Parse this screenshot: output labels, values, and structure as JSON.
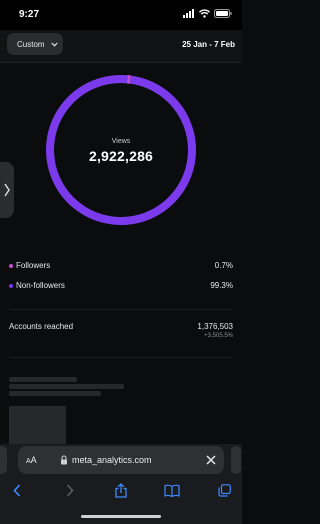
{
  "status": {
    "time": "9:27"
  },
  "filter": {
    "range_label": "Custom",
    "date_range": "25 Jan - 7 Feb"
  },
  "views": {
    "label": "Views",
    "value": "2,922,286"
  },
  "chart_data": {
    "type": "pie",
    "categories": [
      "Followers",
      "Non-followers"
    ],
    "values": [
      0.7,
      99.3
    ],
    "colors": [
      "#c64bd1",
      "#7c3aed"
    ],
    "title": "",
    "center_label": "Views",
    "center_value": "2,922,286"
  },
  "legend": [
    {
      "label": "Followers",
      "percent": "0.7%",
      "color": "#c64bd1"
    },
    {
      "label": "Non-followers",
      "percent": "99.3%",
      "color": "#7c3aed"
    }
  ],
  "accounts_reached": {
    "label": "Accounts reached",
    "value": "1,376,503",
    "delta": "+3,505.5%"
  },
  "browser": {
    "aa_small": "A",
    "aa_large": "A",
    "url": "meta_analytics.com"
  },
  "colors": {
    "accent": "#7c3aed",
    "followers": "#c64bd1",
    "link": "#3d8bff",
    "background": "#0b0c0e"
  },
  "icons": [
    "signal-icon",
    "wifi-icon",
    "battery-icon",
    "chevron-down-icon",
    "chevron-right-icon",
    "lock-icon",
    "close-icon",
    "back-icon",
    "forward-icon",
    "share-icon",
    "bookmarks-icon",
    "tabs-icon"
  ]
}
